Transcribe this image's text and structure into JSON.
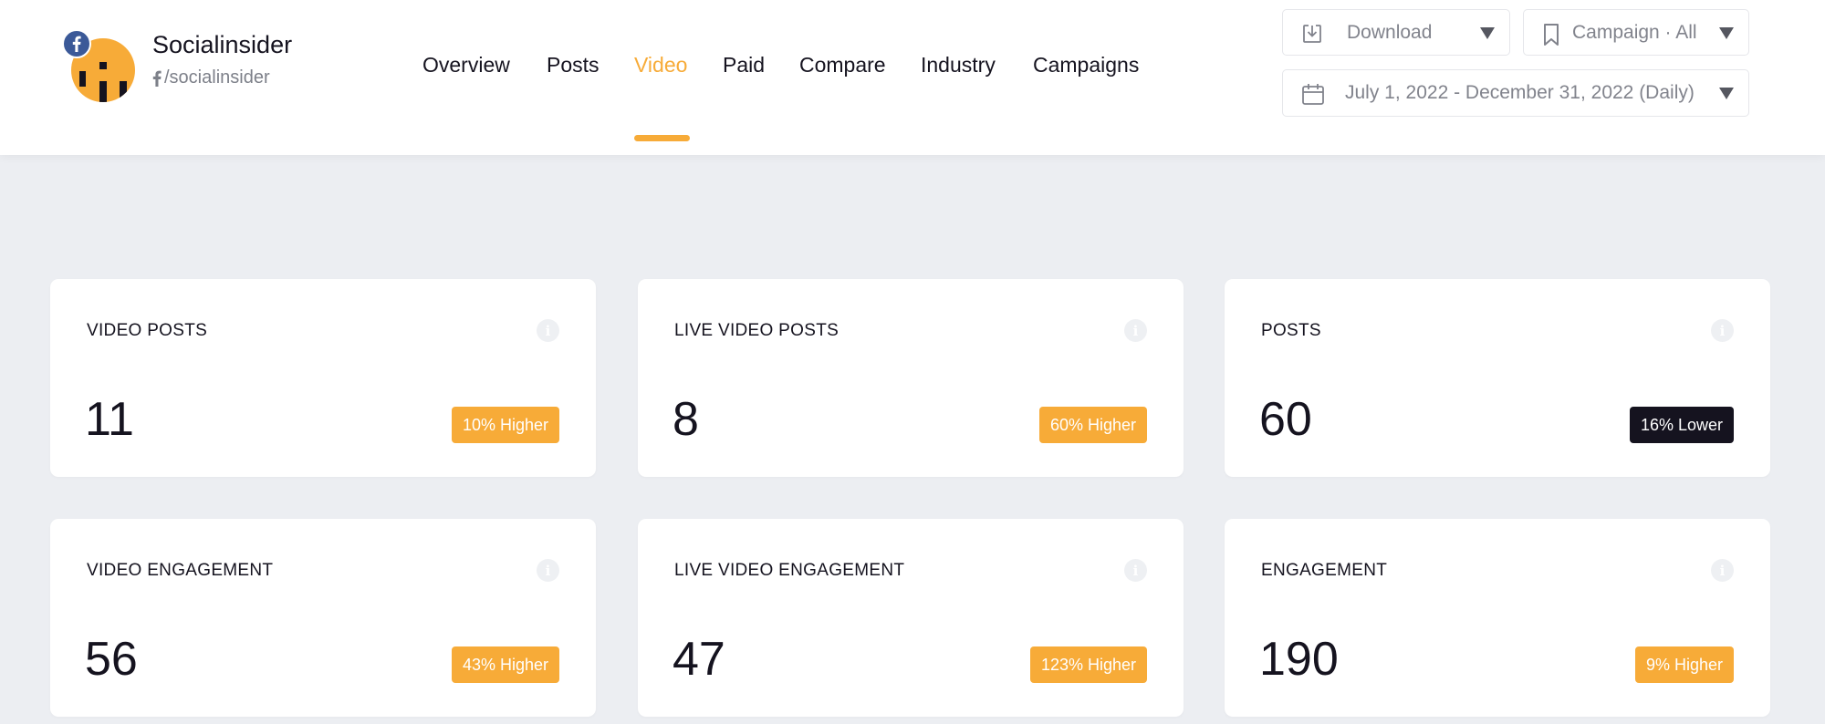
{
  "brand": {
    "name": "Socialinsider",
    "handle": "/socialinsider",
    "network_icon": "facebook-icon"
  },
  "nav": {
    "items": [
      {
        "label": "Overview",
        "active": false
      },
      {
        "label": "Posts",
        "active": false
      },
      {
        "label": "Video",
        "active": true
      },
      {
        "label": "Paid",
        "active": false
      },
      {
        "label": "Compare",
        "active": false
      },
      {
        "label": "Industry",
        "active": false
      },
      {
        "label": "Campaigns",
        "active": false
      }
    ]
  },
  "toolbar": {
    "download_label": "Download",
    "campaign_label": "Campaign · All",
    "date_range_label": "July 1, 2022 - December 31, 2022 (Daily)"
  },
  "colors": {
    "accent": "#f7ab38",
    "dark": "#15131f",
    "background": "#eceef2"
  },
  "cards": [
    {
      "title": "VIDEO POSTS",
      "value": "11",
      "badge": "10% Higher",
      "trend": "higher"
    },
    {
      "title": "LIVE VIDEO POSTS",
      "value": "8",
      "badge": "60% Higher",
      "trend": "higher"
    },
    {
      "title": "POSTS",
      "value": "60",
      "badge": "16% Lower",
      "trend": "lower"
    },
    {
      "title": "VIDEO ENGAGEMENT",
      "value": "56",
      "badge": "43% Higher",
      "trend": "higher"
    },
    {
      "title": "LIVE VIDEO ENGAGEMENT",
      "value": "47",
      "badge": "123% Higher",
      "trend": "higher"
    },
    {
      "title": "ENGAGEMENT",
      "value": "190",
      "badge": "9% Higher",
      "trend": "higher"
    }
  ]
}
